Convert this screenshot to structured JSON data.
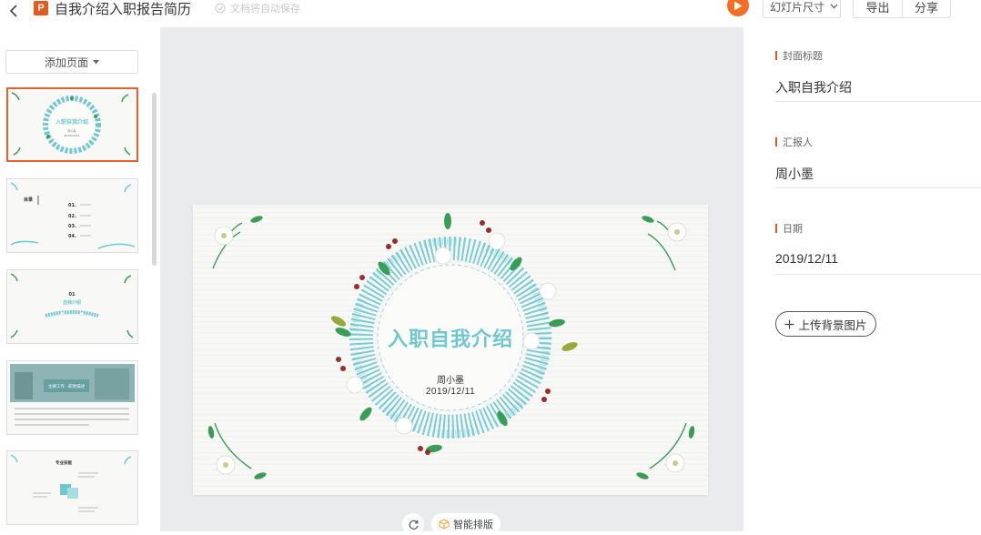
{
  "header": {
    "title": "自我介绍入职报告简历",
    "save_status": "文档将自动保存",
    "logo_letter": "P",
    "slide_size_label": "幻灯片尺寸",
    "export_label": "导出",
    "share_label": "分享"
  },
  "sidebar": {
    "add_page_label": "添加页面",
    "thumbnails": [
      {
        "title": "入职自我介绍",
        "sub1": "周小墨",
        "sub2": "2019/12/11"
      },
      {
        "title": "目录",
        "items": [
          "01.",
          "02.",
          "03.",
          "04."
        ]
      },
      {
        "title": "01",
        "sub1": "自我介绍"
      },
      {
        "title": "主要工作 · 职责描述"
      },
      {
        "title": "专业技能"
      }
    ]
  },
  "slide": {
    "title": "入职自我介绍",
    "name": "周小墨",
    "date": "2019/12/11"
  },
  "tools": {
    "smart_layout_label": "智能排版"
  },
  "panel": {
    "fields": [
      {
        "label": "封面标题",
        "value": "入职自我介绍"
      },
      {
        "label": "汇报人",
        "value": "周小墨"
      },
      {
        "label": "日期",
        "value": "2019/12/11"
      }
    ],
    "upload_label": "上传背景图片"
  },
  "colors": {
    "accent": "#e8571e",
    "play": "#f46d21",
    "slide_title": "#6fc8cf",
    "wreath_blue": "#5fc3cf",
    "leaf_green": "#3a9d56",
    "berry_red": "#9b2c2c"
  }
}
